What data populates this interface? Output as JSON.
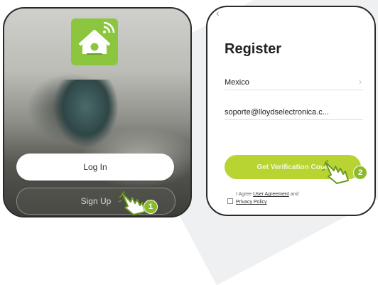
{
  "left_screen": {
    "login_label": "Log In",
    "signup_label": "Sign Up"
  },
  "right_screen": {
    "title": "Register",
    "country_value": "Mexico",
    "email_value": "soporte@lloydselectronica.c...",
    "verify_label": "Get Verification Code",
    "agree_prefix": "I Agree",
    "user_agreement_label": "User Agreement",
    "agree_and": "and",
    "privacy_policy_label": "Privacy Policy"
  },
  "steps": {
    "step1": "1",
    "step2": "2"
  },
  "colors": {
    "brand_green": "#8cc63f",
    "button_green": "#b7d432",
    "badge_green": "#8bbb2b"
  },
  "icons": [
    "house-wifi-logo-icon",
    "back-arrow-icon",
    "chevron-right-icon",
    "hand-pointer-icon"
  ]
}
